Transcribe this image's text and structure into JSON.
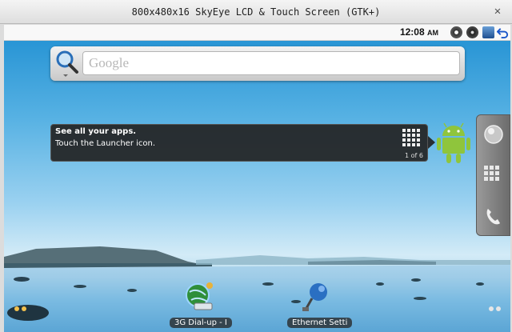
{
  "window": {
    "title": "800x480x16 SkyEye LCD & Touch Screen (GTK+)",
    "close_icon": "close-icon"
  },
  "statusbar": {
    "time": "12:08",
    "ampm": "AM"
  },
  "search": {
    "placeholder": "Google"
  },
  "tip": {
    "title": "See all your apps.",
    "body": "Touch the Launcher icon.",
    "count": "1 of 6"
  },
  "shortcuts": [
    {
      "label": "3G Dial-up - I"
    },
    {
      "label": "Ethernet Setti"
    }
  ],
  "colors": {
    "accent_green": "#8fc53c",
    "sky_top": "#1f8fd2"
  }
}
